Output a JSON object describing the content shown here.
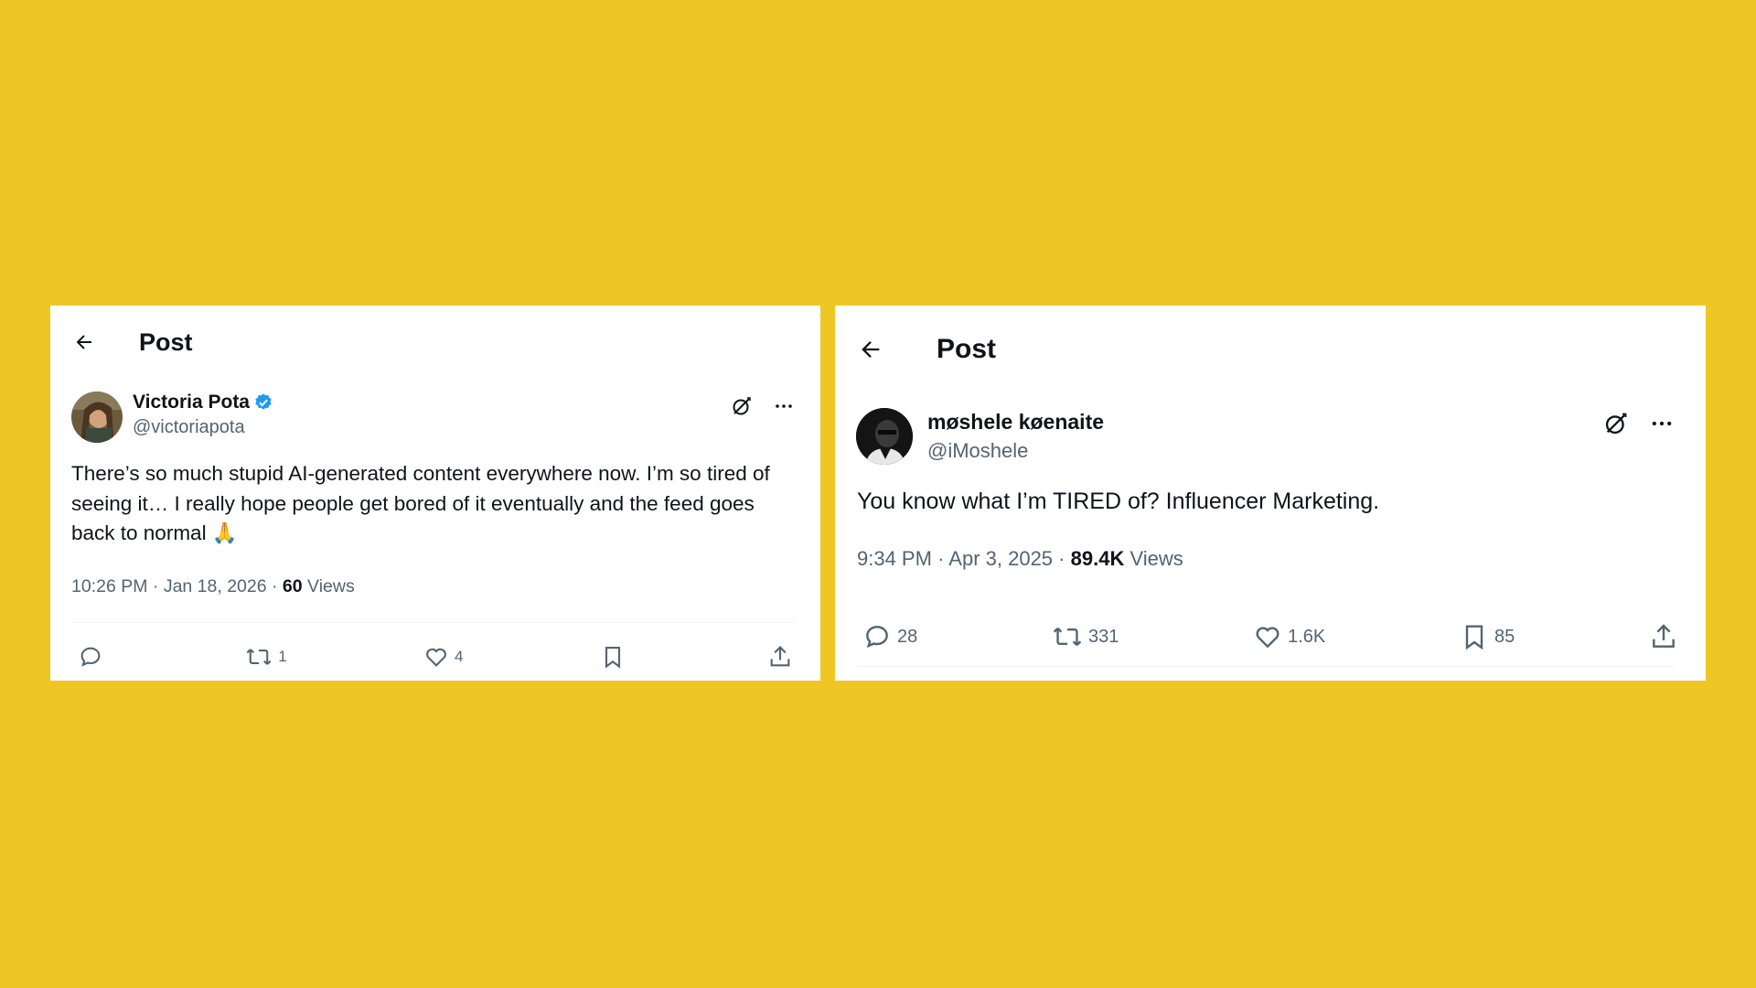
{
  "colors": {
    "background": "#EEC725",
    "verified": "#1D9BF0",
    "text_primary": "#0F1419",
    "text_secondary": "#536471"
  },
  "posts": [
    {
      "header_title": "Post",
      "display_name": "Victoria Pota",
      "handle": "@victoriapota",
      "verified": true,
      "text": "There’s so much stupid AI-generated content everywhere now. I’m so tired of seeing it… I really hope people get bored of it eventually and the feed goes back to normal 🙏",
      "time": "10:26 PM",
      "date": "Jan 18, 2026",
      "views_count": "60",
      "views_label": "Views",
      "stats": {
        "replies": "",
        "reposts": "1",
        "likes": "4",
        "bookmarks": ""
      }
    },
    {
      "header_title": "Post",
      "display_name": "møshele køenaite",
      "handle": "@iMoshele",
      "verified": false,
      "text": "You know what I’m TIRED of? Influencer Marketing.",
      "time": "9:34 PM",
      "date": "Apr 3, 2025",
      "views_count": "89.4K",
      "views_label": "Views",
      "stats": {
        "replies": "28",
        "reposts": "331",
        "likes": "1.6K",
        "bookmarks": "85"
      }
    }
  ]
}
